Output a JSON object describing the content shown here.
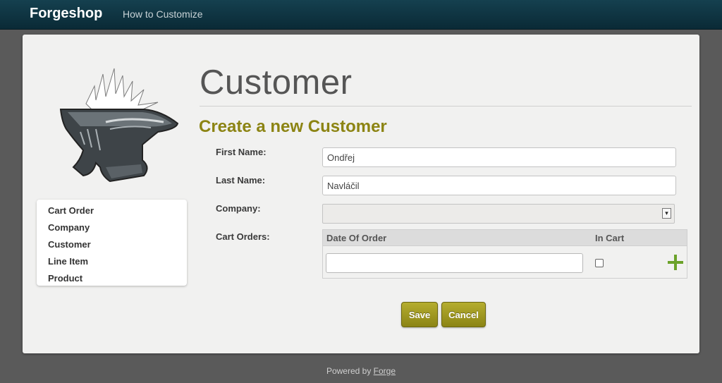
{
  "navbar": {
    "brand": "Forgeshop",
    "link": "How to Customize"
  },
  "sidebar": {
    "items": [
      {
        "label": "Cart Order"
      },
      {
        "label": "Company"
      },
      {
        "label": "Customer"
      },
      {
        "label": "Line Item"
      },
      {
        "label": "Product"
      }
    ]
  },
  "main": {
    "title": "Customer",
    "subtitle": "Create a new Customer"
  },
  "form": {
    "first_name": {
      "label": "First Name:",
      "value": "Ondřej"
    },
    "last_name": {
      "label": "Last Name:",
      "value": "Navláčil"
    },
    "company": {
      "label": "Company:",
      "value": ""
    },
    "cart_orders": {
      "label": "Cart Orders:",
      "columns": [
        "Date Of Order",
        "In Cart"
      ],
      "new_row": {
        "date_value": "",
        "in_cart": false
      }
    }
  },
  "actions": {
    "save_label": "Save",
    "cancel_label": "Cancel"
  },
  "footer": {
    "text": "Powered by",
    "link": "Forge"
  },
  "icons": {
    "logo": "anvil-logo-icon",
    "select_arrow": "chevron-down-icon",
    "add": "plus-icon"
  },
  "colors": {
    "navbar": "#0f3442",
    "accent": "#8c8413",
    "add_icon": "#6ba22a"
  }
}
